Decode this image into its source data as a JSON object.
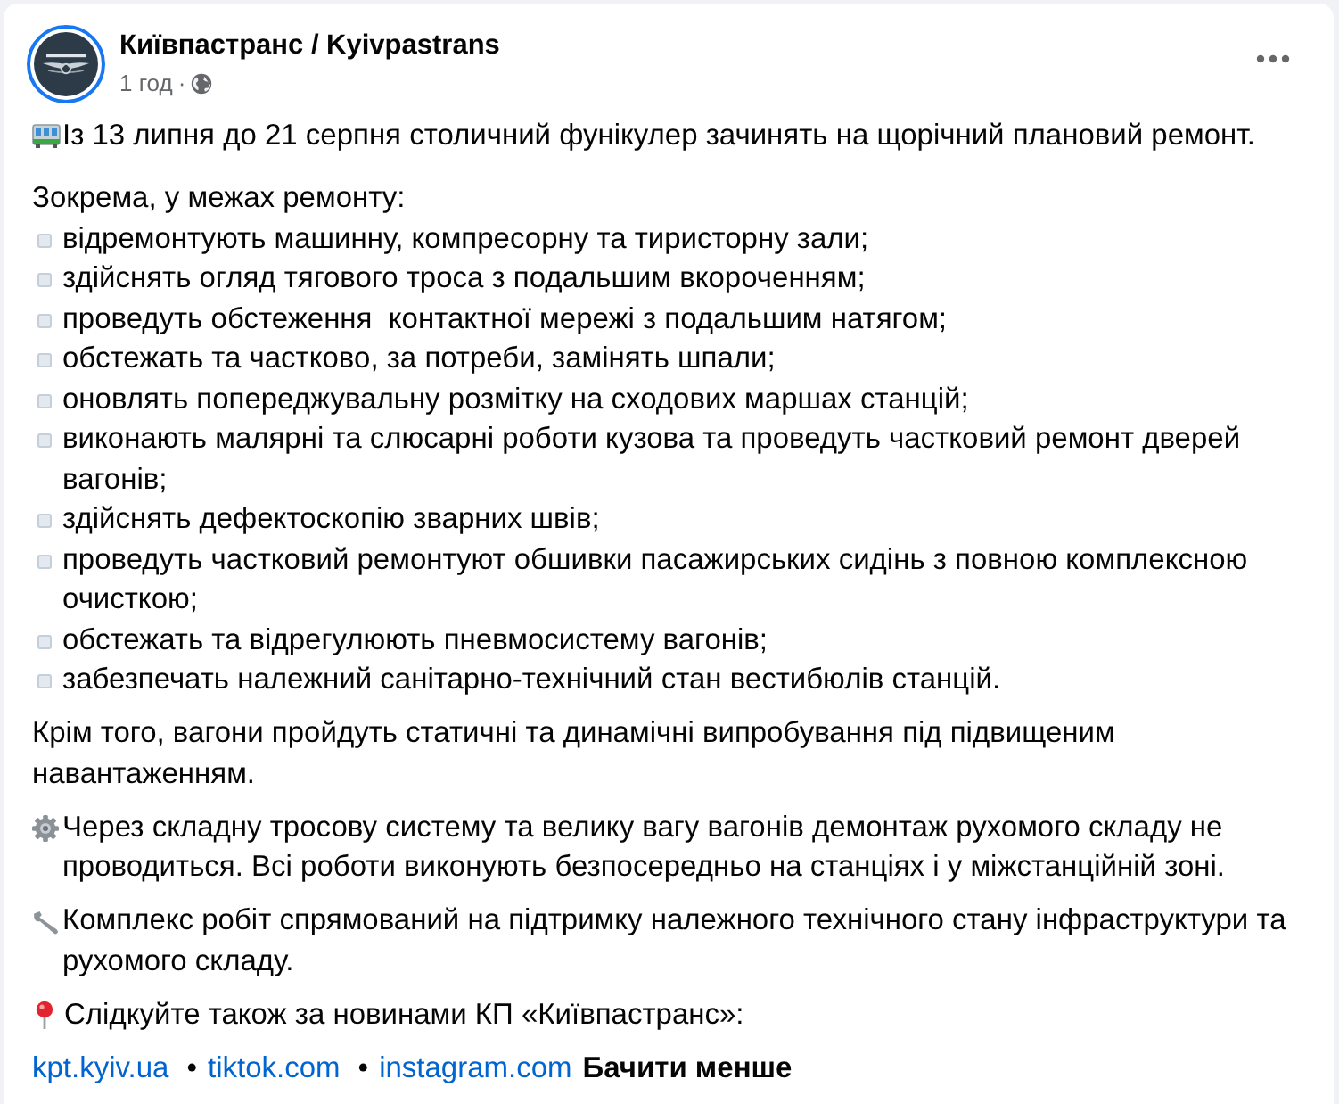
{
  "post": {
    "author": "Київпастранс / Kyivpastrans",
    "time": "1 год",
    "dot": "·"
  },
  "body": [
    {
      "kind": "tram",
      "text": "Із 13 липня до 21 серпня столичний фунікулер зачинять на щорічний плановий ремонт."
    },
    {
      "kind": "list",
      "title": "Зокрема, у межах ремонту:",
      "items": [
        "відремонтують машинну, компресорну та тиристорну зали;",
        "здійснять огляд тягового троса з подальшим вкороченням;",
        "проведуть обстеження  контактної мережі з подальшим натягом;",
        "обстежать та частково, за потреби, замінять шпали;",
        "оновлять попереджувальну розмітку на сходових маршах станцій;",
        "виконають малярні та слюсарні роботи кузова та проведуть частковий ремонт дверей вагонів;",
        "здійснять дефектоскопію зварних швів;",
        "проведуть частковий ремонтуют обшивки пасажирських сидінь з повною комплексною очисткою;",
        "обстежать та відрегулюють пневмосистему вагонів;",
        "забезпечать належний санітарно-технічний стан вестибюлів станцій."
      ]
    },
    {
      "kind": "plain",
      "text": "Крім того, вагони пройдуть статичні та динамічні випробування під підвищеним навантаженням."
    },
    {
      "kind": "gear",
      "text": "Через складну тросову систему та велику вагу вагонів демонтаж рухомого складу не проводиться. Всі роботи виконують безпосередньо на станціях і у міжстанційній зоні."
    },
    {
      "kind": "wrench",
      "text": "Комплекс робіт спрямований на підтримку належного технічного стану інфраструктури та рухомого складу."
    },
    {
      "kind": "pin",
      "text": "Слідкуйте також за новинами КП «Київпастранс»:"
    },
    {
      "kind": "links",
      "items": [
        {
          "kind": "link",
          "text": "kpt.kyiv.ua"
        },
        {
          "kind": "separator",
          "text": "•"
        },
        {
          "kind": "link",
          "text": "tiktok.com"
        },
        {
          "kind": "separator",
          "text": "•"
        },
        {
          "kind": "link",
          "text": "instagram.com"
        },
        {
          "kind": "toggle",
          "text": "Бачити менше"
        }
      ]
    }
  ]
}
